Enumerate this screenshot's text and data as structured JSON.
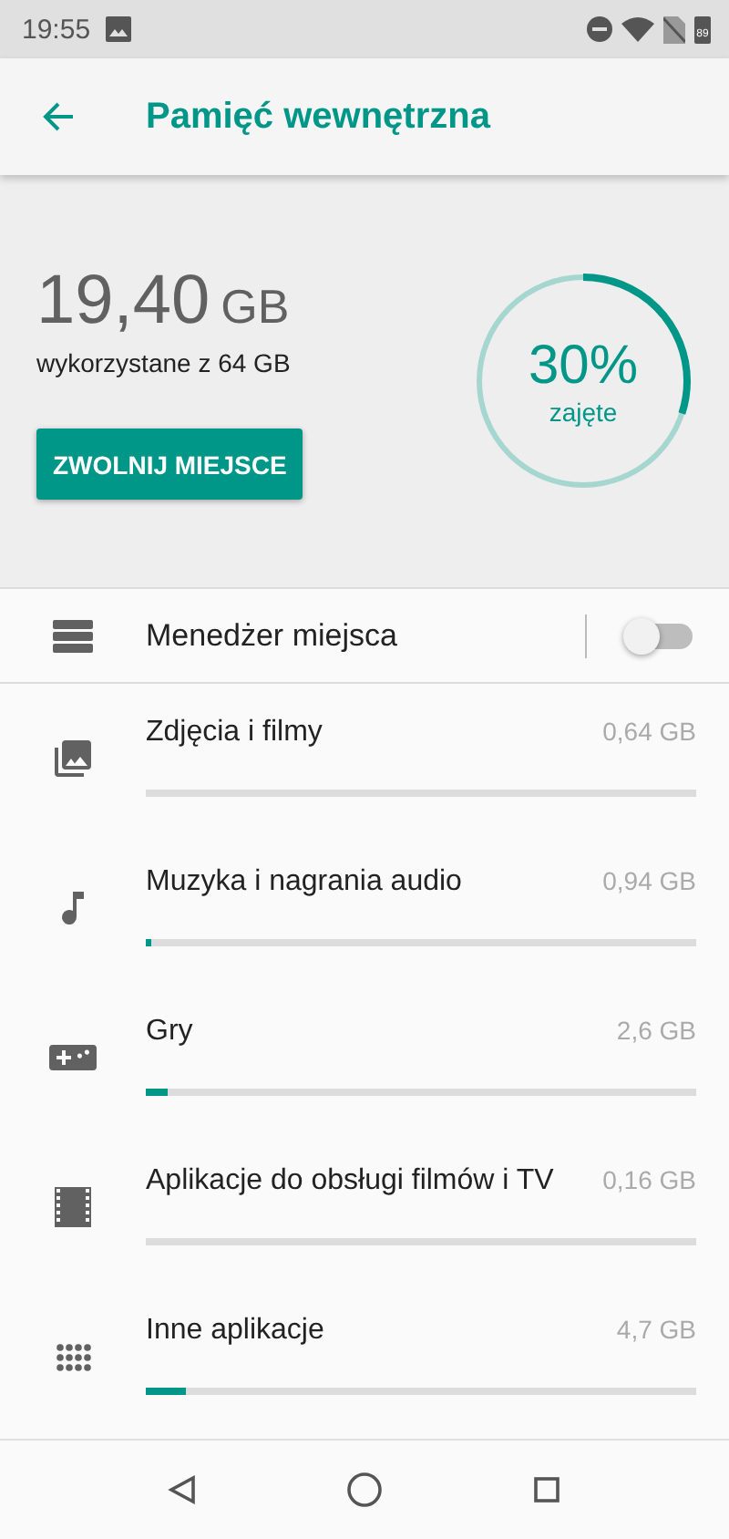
{
  "status_bar": {
    "time": "19:55",
    "battery_text": "89"
  },
  "app_bar": {
    "title": "Pamięć wewnętrzna"
  },
  "summary": {
    "used_value": "19,40",
    "used_unit": "GB",
    "used_caption": "wykorzystane z 64 GB",
    "button": "ZWOLNIJ MIEJSCE",
    "ring": {
      "percent": "30%",
      "caption": "zajęte"
    }
  },
  "manager": {
    "label": "Menedżer miejsca",
    "on": false
  },
  "categories": [
    {
      "kind": "photos",
      "title": "Zdjęcia i filmy",
      "size": "0,64 GB"
    },
    {
      "kind": "music",
      "title": "Muzyka i nagrania audio",
      "size": "0,94 GB",
      "level": 0.01
    },
    {
      "kind": "games",
      "title": "Gry",
      "size": "2,6 GB",
      "level": 0.04
    },
    {
      "kind": "movies",
      "title": "Aplikacje do obsługi filmów i TV",
      "size": "0,16 GB"
    },
    {
      "kind": "apps",
      "title": "Inne aplikacje",
      "size": "4,7 GB",
      "level": 0.072
    }
  ]
}
